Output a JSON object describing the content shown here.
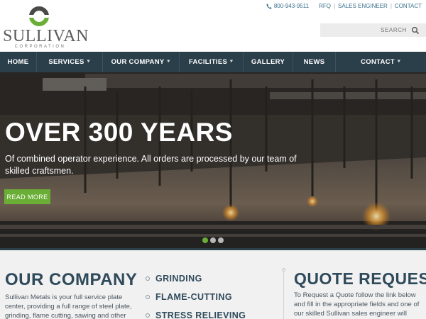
{
  "brand": {
    "name": "SULLIVAN",
    "subtitle": "CORPORATION",
    "colors": {
      "green": "#6aae36",
      "navy": "#2b3f4b",
      "heading": "#2f4a5b"
    }
  },
  "top_links": {
    "phone_icon": "phone-icon",
    "phone": "800-943-9511",
    "links": [
      "RFQ",
      "SALES ENGINEER",
      "CONTACT"
    ],
    "separator": "|"
  },
  "search": {
    "placeholder": "SEARCH",
    "icon": "search-icon"
  },
  "nav": {
    "items": [
      {
        "label": "HOME",
        "dropdown": false
      },
      {
        "label": "SERVICES",
        "dropdown": true
      },
      {
        "label": "OUR COMPANY",
        "dropdown": true
      },
      {
        "label": "FACILITIES",
        "dropdown": true
      },
      {
        "label": "GALLERY",
        "dropdown": false
      },
      {
        "label": "NEWS",
        "dropdown": false
      },
      {
        "label": "CONTACT",
        "dropdown": true
      }
    ],
    "chevron": "❯"
  },
  "hero": {
    "title": "OVER 300 YEARS",
    "text": "Of combined operator experience. All orders are processed by our team of skilled craftsmen.",
    "button": "READ MORE",
    "slides": 3,
    "active_slide": 1
  },
  "company": {
    "heading": "OUR COMPANY",
    "text": "Sullivan Metals is your full service plate center, providing a full range of steel plate, grinding, flame cutting, sawing and other"
  },
  "services": [
    "GRINDING",
    "FLAME-CUTTING",
    "STRESS RELIEVING"
  ],
  "quote": {
    "heading": "QUOTE REQUEST",
    "text": "To Request a Quote follow the link below and fill in the appropriate fields and one of our skilled Sullivan sales engineer will"
  }
}
